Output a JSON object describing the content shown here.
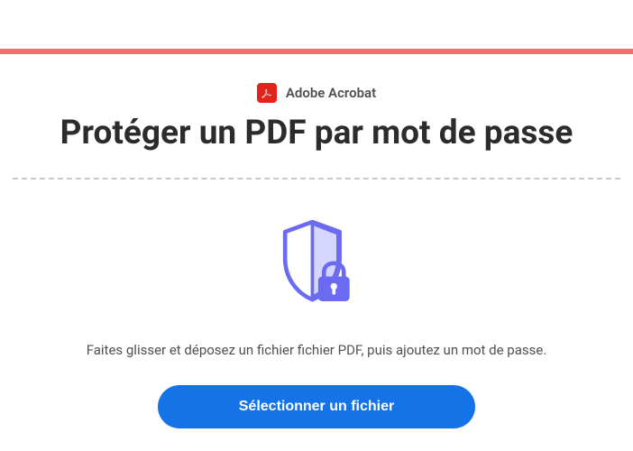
{
  "brand": {
    "label": "Adobe Acrobat"
  },
  "header": {
    "title": "Protéger un PDF par mot de passe"
  },
  "main": {
    "instructions": "Faites glisser et déposez un fichier fichier PDF, puis ajoutez un mot de passe.",
    "select_button_label": "Sélectionner un fichier"
  },
  "colors": {
    "accent_red": "#e1251b",
    "divider_red": "#f46e6e",
    "button_blue": "#1473e6",
    "icon_purple": "#6b6bf2"
  }
}
